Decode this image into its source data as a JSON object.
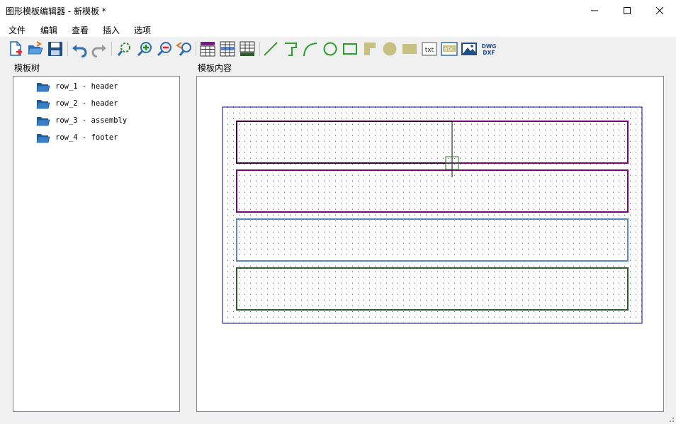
{
  "window": {
    "title": "图形模板编辑器 - 新模板 *",
    "controls": [
      "minimize",
      "maximize",
      "close"
    ]
  },
  "menu": {
    "items": [
      {
        "label": "文件"
      },
      {
        "label": "编辑"
      },
      {
        "label": "查看"
      },
      {
        "label": "插入"
      },
      {
        "label": "选项"
      }
    ]
  },
  "toolbar": {
    "groups": [
      [
        "new-file-icon",
        "open-folder-icon",
        "save-icon"
      ],
      [
        "undo-icon",
        "redo-icon"
      ],
      [
        "zoom-fit-icon",
        "zoom-in-icon",
        "zoom-out-icon",
        "zoom-previous-icon"
      ],
      [
        "table-header-icon",
        "table-rows-icon",
        "table-footer-icon"
      ],
      [
        "line-icon",
        "polyline-icon",
        "arc-icon",
        "circle-icon",
        "rectangle-icon",
        "filled-polygon-icon",
        "filled-circle-icon",
        "filled-rectangle-icon",
        "text-icon",
        "attribute-text-icon",
        "image-icon",
        "dwg-dxf-icon"
      ]
    ],
    "text_icon_label": "txt",
    "attribute_icon_label": "abc",
    "dwg_label_top": "DWG",
    "dwg_label_bottom": "DXF"
  },
  "tree_panel": {
    "title": "模板树",
    "items": [
      {
        "label": "row_1 - header"
      },
      {
        "label": "row_2 - header"
      },
      {
        "label": "row_3 - assembly"
      },
      {
        "label": "row_4 - footer"
      }
    ]
  },
  "canvas_panel": {
    "title": "模板内容",
    "rows": [
      {
        "name": "row_1",
        "color": "#800080"
      },
      {
        "name": "row_2",
        "color": "#800080"
      },
      {
        "name": "row_3",
        "color": "#5b87c6"
      },
      {
        "name": "row_4",
        "color": "#2e5e2e"
      }
    ],
    "page_border_color": "#0000aa",
    "selection_color": "#000000",
    "cursor_color": "#1f7a1f",
    "grid_dot_color": "#555555"
  },
  "colors": {
    "folder_icon": "#1f5c99",
    "toolbar_shape": "#c8c080",
    "toolbar_line": "#2aa02a"
  }
}
